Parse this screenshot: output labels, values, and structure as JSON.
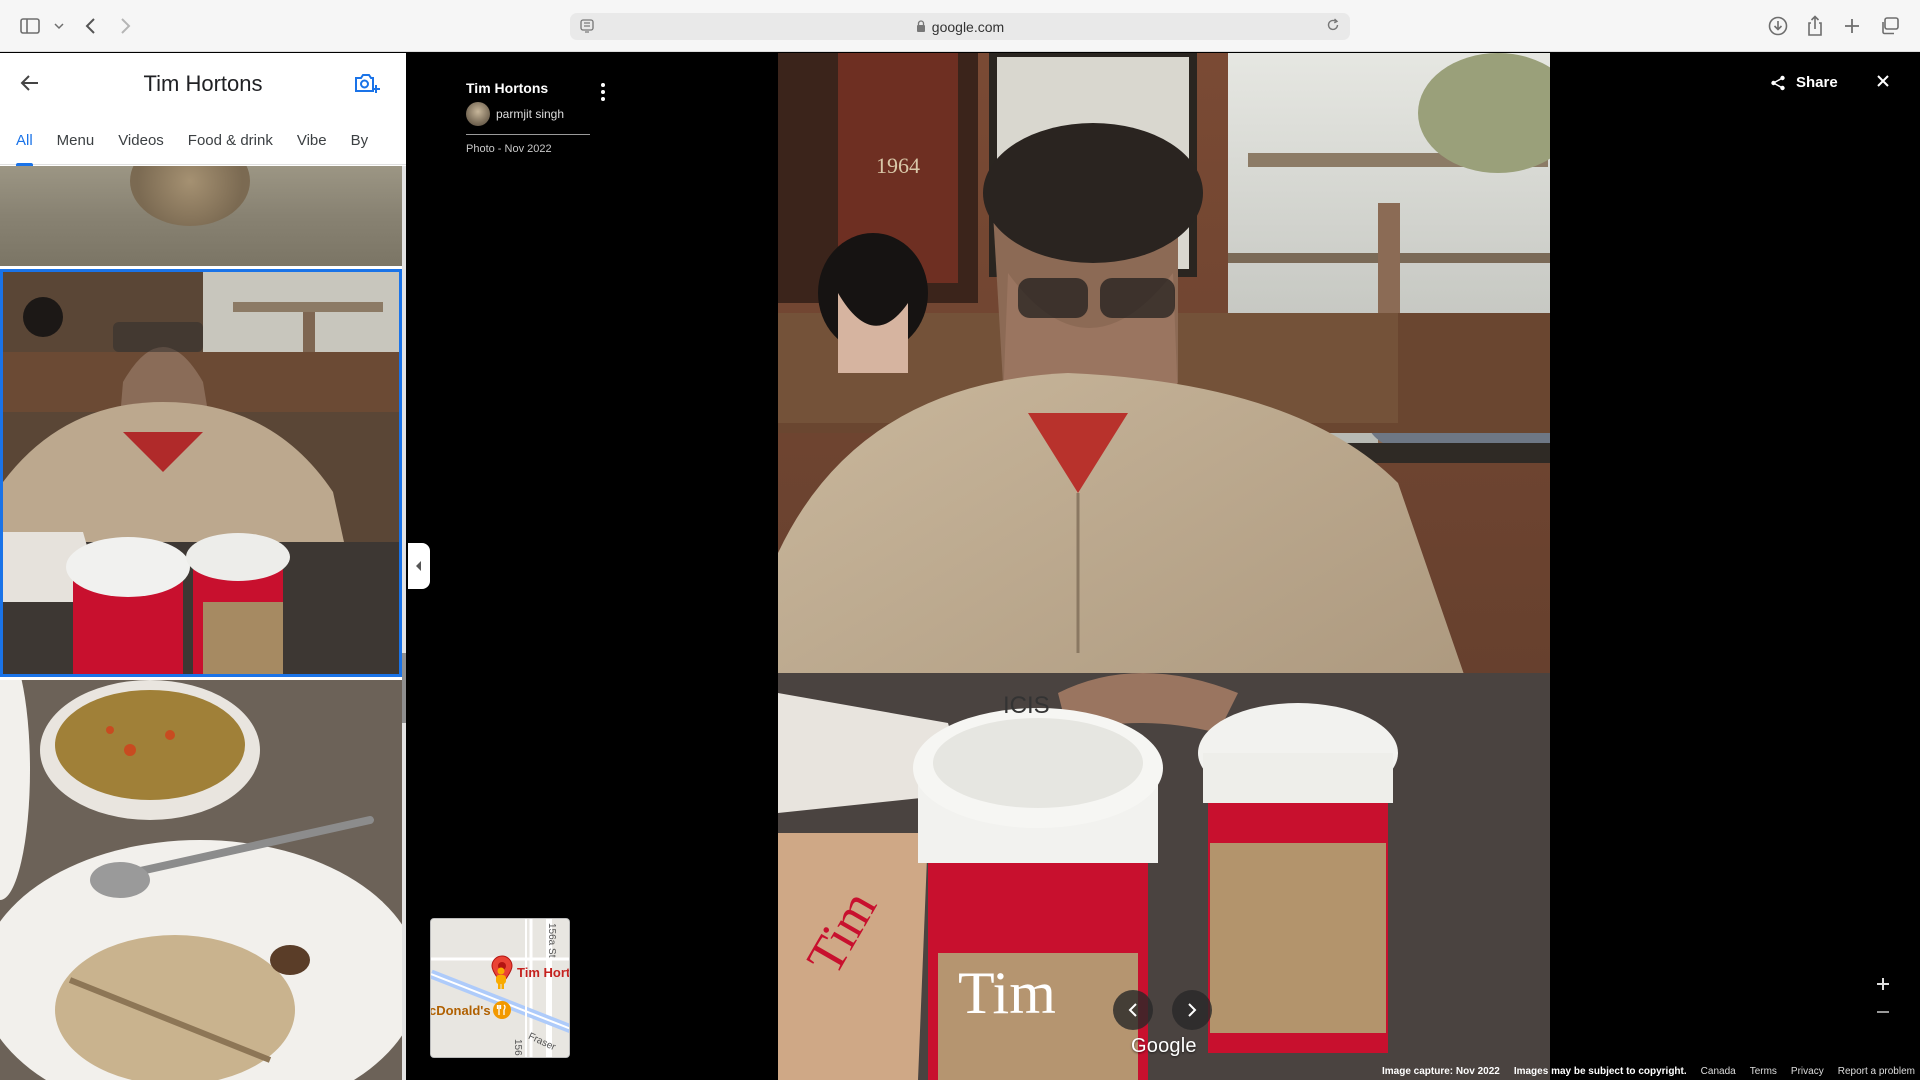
{
  "browser": {
    "url": "google.com"
  },
  "panel": {
    "title": "Tim Hortons",
    "tabs": [
      {
        "label": "All",
        "active": true
      },
      {
        "label": "Menu",
        "active": false
      },
      {
        "label": "Videos",
        "active": false
      },
      {
        "label": "Food & drink",
        "active": false
      },
      {
        "label": "Vibe",
        "active": false
      },
      {
        "label": "By",
        "active": false
      }
    ]
  },
  "photo_info": {
    "place": "Tim Hortons",
    "contributor": "parmjit singh",
    "meta": "Photo - Nov 2022"
  },
  "minimap": {
    "place_label": "Tim Hort",
    "poi_label": "cDonald's",
    "street1": "156a St",
    "street2": "Fraser",
    "street3": "156"
  },
  "viewer": {
    "share_label": "Share",
    "logo": "Google"
  },
  "footer": {
    "capture": "Image capture: Nov 2022",
    "copyright": "Images may be subject to copyright.",
    "country": "Canada",
    "terms": "Terms",
    "privacy": "Privacy",
    "report": "Report a problem"
  },
  "colors": {
    "accent": "#1a73e8",
    "viewer_bg": "#000000",
    "cup_red": "#c8102e"
  }
}
